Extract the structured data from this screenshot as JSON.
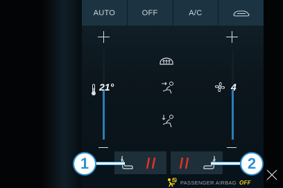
{
  "topbar": {
    "auto_label": "AUTO",
    "off_label": "OFF",
    "ac_label": "A/C",
    "recirc_icon": "car-recirculation-icon"
  },
  "temperature": {
    "value": "21°",
    "level": 0.55,
    "icon": "thermometer-icon"
  },
  "fan": {
    "value": "4",
    "level": 0.55,
    "icon": "fan-icon"
  },
  "airflow_modes": [
    {
      "name": "windshield-defrost-icon"
    },
    {
      "name": "airflow-face-icon"
    },
    {
      "name": "airflow-feet-icon"
    }
  ],
  "seats": {
    "left_callout": "1",
    "right_callout": "2",
    "heat_color": "#e0312b"
  },
  "airbag": {
    "label": "PASSENGER AIRBAG",
    "state": "OFF",
    "state_color": "#f2d21a"
  },
  "accent_color": "#2e7db5"
}
